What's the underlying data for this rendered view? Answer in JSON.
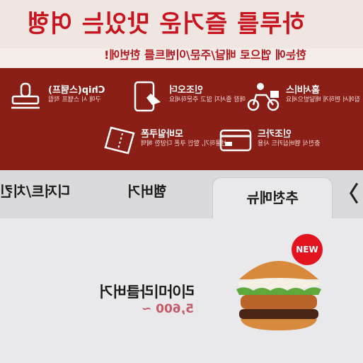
{
  "banner": {
    "title": "하루를 즐거운 맛있는 여행",
    "subtitle": "한눈에 앱으로 배달/주문/이벤트를 한번에!",
    "services": [
      {
        "name": "홈서비스",
        "desc": "집에서 편하게 배달받으세요",
        "icon": "delivery-scooter-icon"
      },
      {
        "name": "인조오더",
        "desc": "매장 줄서지 않고 주문하세요",
        "icon": "mobile-order-icon"
      },
      {
        "name": "Chip(스탬프)",
        "desc": "구매 시 스탬프 적립",
        "icon": "stamp-icon"
      },
      {
        "name": "인조카드",
        "desc": "충전식 멤버십카드 사용",
        "icon": "card-icon"
      },
      {
        "name": "모바일쿠폰",
        "desc": "선물하기, 할인 쿠폰 다양한 혜택",
        "icon": "coupon-icon"
      }
    ]
  },
  "tabs": [
    {
      "label": "추천메뉴",
      "active": true
    },
    {
      "label": "햄버거",
      "active": false
    },
    {
      "label": "디저트/치킨",
      "active": false
    }
  ],
  "nav": {
    "prev_icon": "chevron-left-icon",
    "prev_glyph": "〈"
  },
  "menu": {
    "name": "리아미라클버거",
    "price": "5,600 ~",
    "badge": "NEW"
  },
  "colors": {
    "accent": "#c8141e",
    "service_bg": "#8a1f17",
    "price": "#c45a6a"
  }
}
